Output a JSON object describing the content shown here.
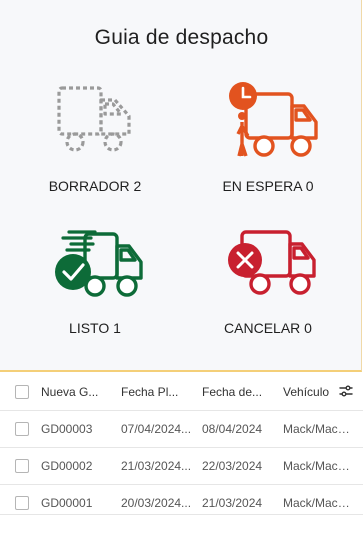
{
  "header": {
    "title": "Guia de despacho"
  },
  "status_cards": [
    {
      "label": "BORRADOR 2",
      "icon": "dashed-truck-icon",
      "color": "#9a9a9a"
    },
    {
      "label": "EN ESPERA 0",
      "icon": "truck-clock-icon",
      "color": "#e2531f"
    },
    {
      "label": "LISTO 1",
      "icon": "truck-check-icon",
      "color": "#0d6b38"
    },
    {
      "label": "CANCELAR 0",
      "icon": "truck-cancel-icon",
      "color": "#c8202f"
    }
  ],
  "table": {
    "columns": [
      "Nueva G...",
      "Fecha Pl...",
      "Fecha de...",
      "Vehículo"
    ],
    "rows": [
      [
        "GD00003",
        "07/04/2024...",
        "08/04/2024",
        "Mack/Mack..."
      ],
      [
        "GD00002",
        "21/03/2024...",
        "22/03/2024",
        "Mack/Mack..."
      ],
      [
        "GD00001",
        "20/03/2024...",
        "21/03/2024",
        "Mack/Mack..."
      ]
    ]
  },
  "icons": {
    "column_settings": "sliders-icon"
  }
}
